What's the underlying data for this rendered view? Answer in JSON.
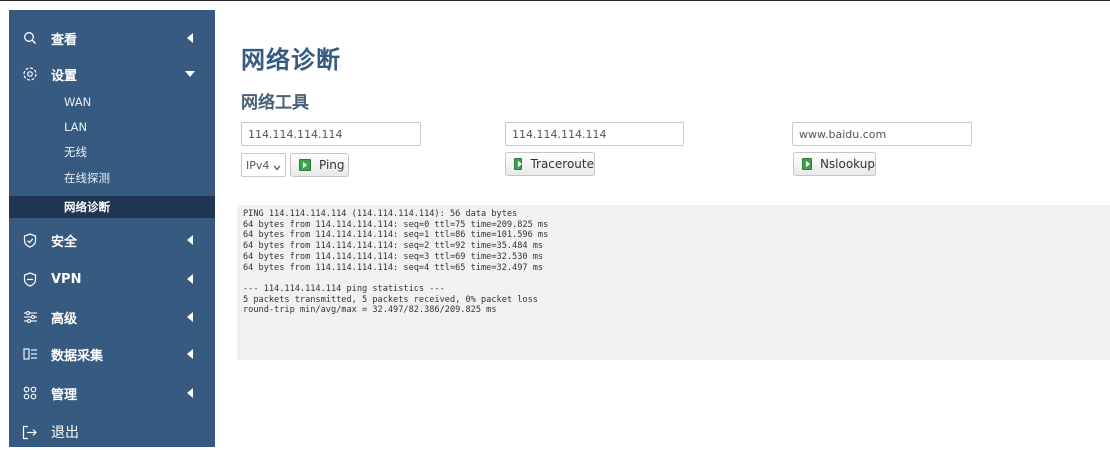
{
  "sidebar": {
    "items": [
      {
        "label": "查看",
        "icon": "search-icon"
      },
      {
        "label": "设置",
        "icon": "gear-icon"
      },
      {
        "label": "安全",
        "icon": "shield-check-icon"
      },
      {
        "label": "VPN",
        "icon": "vpn-shield-icon"
      },
      {
        "label": "高级",
        "icon": "sliders-icon"
      },
      {
        "label": "数据采集",
        "icon": "data-collect-icon"
      },
      {
        "label": "管理",
        "icon": "grid-icon"
      },
      {
        "label": "退出",
        "icon": "logout-icon"
      }
    ],
    "settings_sub": [
      {
        "label": "WAN"
      },
      {
        "label": "LAN"
      },
      {
        "label": "无线"
      },
      {
        "label": "在线探测"
      },
      {
        "label": "网络诊断"
      }
    ]
  },
  "main": {
    "title": "网络诊断",
    "section_title": "网络工具",
    "ping_input": "114.114.114.114",
    "traceroute_input": "114.114.114.114",
    "nslookup_input": "www.baidu.com",
    "ip_version": "IPv4",
    "ping_label": "Ping",
    "traceroute_label": "Traceroute",
    "nslookup_label": "Nslookup",
    "output": "PING 114.114.114.114 (114.114.114.114): 56 data bytes\n64 bytes from 114.114.114.114: seq=0 ttl=75 time=209.825 ms\n64 bytes from 114.114.114.114: seq=1 ttl=86 time=101.596 ms\n64 bytes from 114.114.114.114: seq=2 ttl=92 time=35.484 ms\n64 bytes from 114.114.114.114: seq=3 ttl=69 time=32.530 ms\n64 bytes from 114.114.114.114: seq=4 ttl=65 time=32.497 ms\n\n--- 114.114.114.114 ping statistics ---\n5 packets transmitted, 5 packets received, 0% packet loss\nround-trip min/avg/max = 32.497/82.386/209.825 ms"
  },
  "colors": {
    "sidebar_bg": "#375a80",
    "sidebar_active": "#1f3552",
    "title": "#375a80",
    "button_icon": "#3fa34d"
  }
}
